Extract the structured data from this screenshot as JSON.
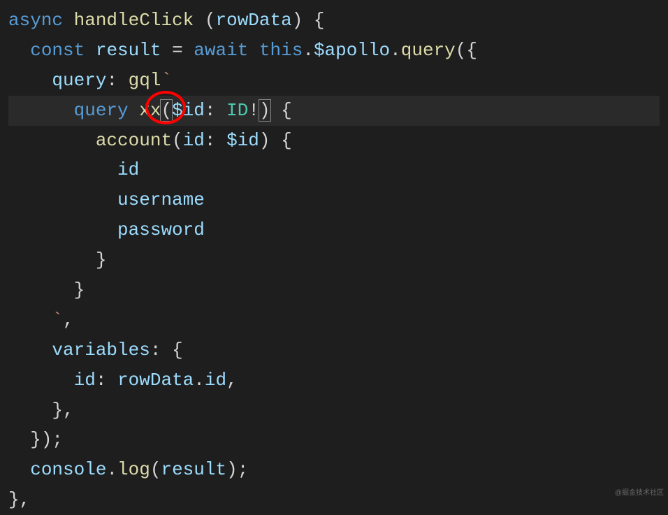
{
  "code": {
    "lines": [
      {
        "indent": 0,
        "tokens": [
          {
            "t": "async",
            "c": "tok-keyword"
          },
          {
            "t": " "
          },
          {
            "t": "handleClick",
            "c": "tok-func"
          },
          {
            "t": " ("
          },
          {
            "t": "rowData",
            "c": "tok-var"
          },
          {
            "t": ") {"
          }
        ]
      },
      {
        "indent": 1,
        "tokens": [
          {
            "t": "const",
            "c": "tok-storage"
          },
          {
            "t": " "
          },
          {
            "t": "result",
            "c": "tok-var"
          },
          {
            "t": " = "
          },
          {
            "t": "await",
            "c": "tok-keyword"
          },
          {
            "t": " "
          },
          {
            "t": "this",
            "c": "tok-this"
          },
          {
            "t": "."
          },
          {
            "t": "$apollo",
            "c": "tok-prop"
          },
          {
            "t": "."
          },
          {
            "t": "query",
            "c": "tok-func"
          },
          {
            "t": "({"
          }
        ]
      },
      {
        "indent": 2,
        "tokens": [
          {
            "t": "query",
            "c": "tok-prop"
          },
          {
            "t": ": "
          },
          {
            "t": "gql",
            "c": "tok-func"
          },
          {
            "t": "`",
            "c": "tok-templ"
          }
        ]
      },
      {
        "indent": 3,
        "highlight": true,
        "tokens": [
          {
            "t": "query",
            "c": "tok-keyword"
          },
          {
            "t": " "
          },
          {
            "t": "xx",
            "c": "tok-func"
          },
          {
            "t": "(",
            "c": "",
            "bm": true
          },
          {
            "t": "$id",
            "c": "tok-var"
          },
          {
            "t": ": "
          },
          {
            "t": "ID",
            "c": "tok-type"
          },
          {
            "t": "!"
          },
          {
            "t": ")",
            "c": "",
            "bm": true
          },
          {
            "t": " {"
          }
        ]
      },
      {
        "indent": 4,
        "tokens": [
          {
            "t": "account",
            "c": "tok-func"
          },
          {
            "t": "("
          },
          {
            "t": "id",
            "c": "tok-prop"
          },
          {
            "t": ": "
          },
          {
            "t": "$id",
            "c": "tok-var"
          },
          {
            "t": ") {"
          }
        ]
      },
      {
        "indent": 5,
        "tokens": [
          {
            "t": "id",
            "c": "tok-prop"
          }
        ]
      },
      {
        "indent": 5,
        "tokens": [
          {
            "t": "username",
            "c": "tok-prop"
          }
        ]
      },
      {
        "indent": 5,
        "tokens": [
          {
            "t": "password",
            "c": "tok-prop"
          }
        ]
      },
      {
        "indent": 4,
        "tokens": [
          {
            "t": "}"
          }
        ]
      },
      {
        "indent": 3,
        "tokens": [
          {
            "t": "}"
          }
        ]
      },
      {
        "indent": 2,
        "tokens": [
          {
            "t": "`",
            "c": "tok-templ"
          },
          {
            "t": ","
          }
        ]
      },
      {
        "indent": 2,
        "tokens": [
          {
            "t": "variables",
            "c": "tok-prop"
          },
          {
            "t": ": {"
          }
        ]
      },
      {
        "indent": 3,
        "tokens": [
          {
            "t": "id",
            "c": "tok-prop"
          },
          {
            "t": ": "
          },
          {
            "t": "rowData",
            "c": "tok-var"
          },
          {
            "t": "."
          },
          {
            "t": "id",
            "c": "tok-prop"
          },
          {
            "t": ","
          }
        ]
      },
      {
        "indent": 2,
        "tokens": [
          {
            "t": "},"
          }
        ]
      },
      {
        "indent": 1,
        "tokens": [
          {
            "t": "});"
          }
        ]
      },
      {
        "indent": 1,
        "tokens": [
          {
            "t": "console",
            "c": "tok-var"
          },
          {
            "t": "."
          },
          {
            "t": "log",
            "c": "tok-func"
          },
          {
            "t": "("
          },
          {
            "t": "result",
            "c": "tok-var"
          },
          {
            "t": ");"
          }
        ]
      },
      {
        "indent": 0,
        "tokens": [
          {
            "t": "},"
          }
        ]
      }
    ]
  },
  "annotation": {
    "circle_target": "xx"
  },
  "watermark": "@掘金技术社区"
}
